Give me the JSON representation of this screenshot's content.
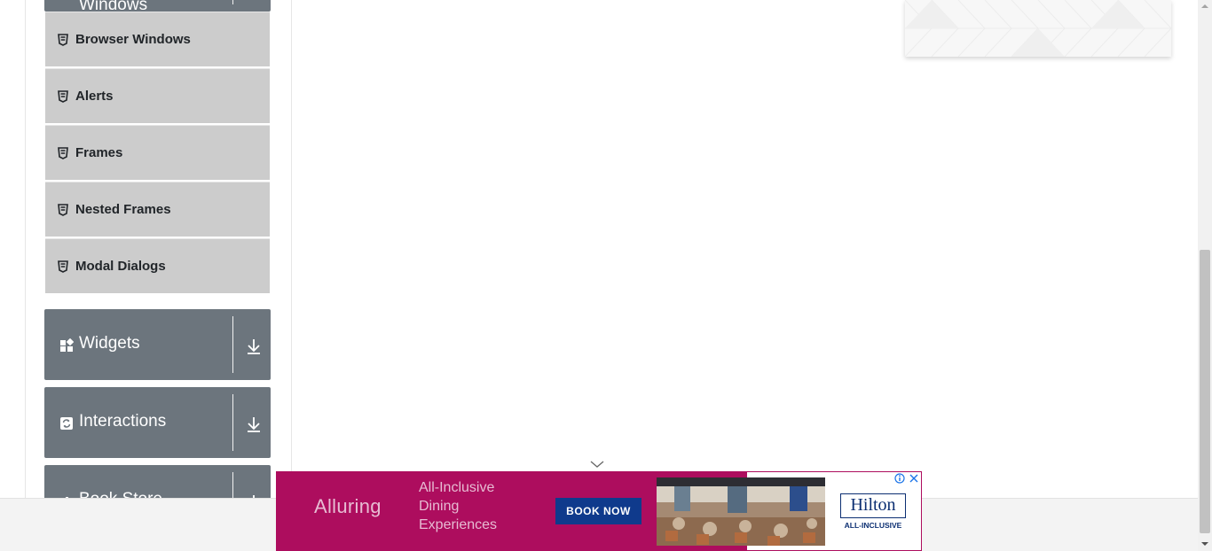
{
  "sidebar": {
    "partial_group": {
      "label": "Windows",
      "icon": "html5-icon"
    },
    "items": [
      {
        "label": "Browser Windows",
        "icon": "html5-icon"
      },
      {
        "label": "Alerts",
        "icon": "html5-icon"
      },
      {
        "label": "Frames",
        "icon": "html5-icon"
      },
      {
        "label": "Nested Frames",
        "icon": "html5-icon"
      },
      {
        "label": "Modal Dialogs",
        "icon": "html5-icon"
      }
    ],
    "groups": [
      {
        "label": "Widgets",
        "icon": "widgets-icon",
        "toggle_icon": "arrow-down-icon"
      },
      {
        "label": "Interactions",
        "icon": "interactions-icon",
        "toggle_icon": "arrow-down-icon"
      },
      {
        "label": "Book Store",
        "icon": "book-store-icon",
        "toggle_icon": "arrow-down-icon"
      }
    ]
  },
  "ad": {
    "brand_word": "Alluring",
    "tagline": "All-Inclusive Dining Experiences",
    "cta": "BOOK NOW",
    "logo": "Hilton",
    "logo_sub": "ALL-INCLUSIVE",
    "colors": {
      "background": "#ad0d5e",
      "cta": "#0f3a8c",
      "logo": "#0c2f72"
    }
  },
  "colors": {
    "group_header": "#6c757d",
    "menu_item": "#cccccc"
  }
}
